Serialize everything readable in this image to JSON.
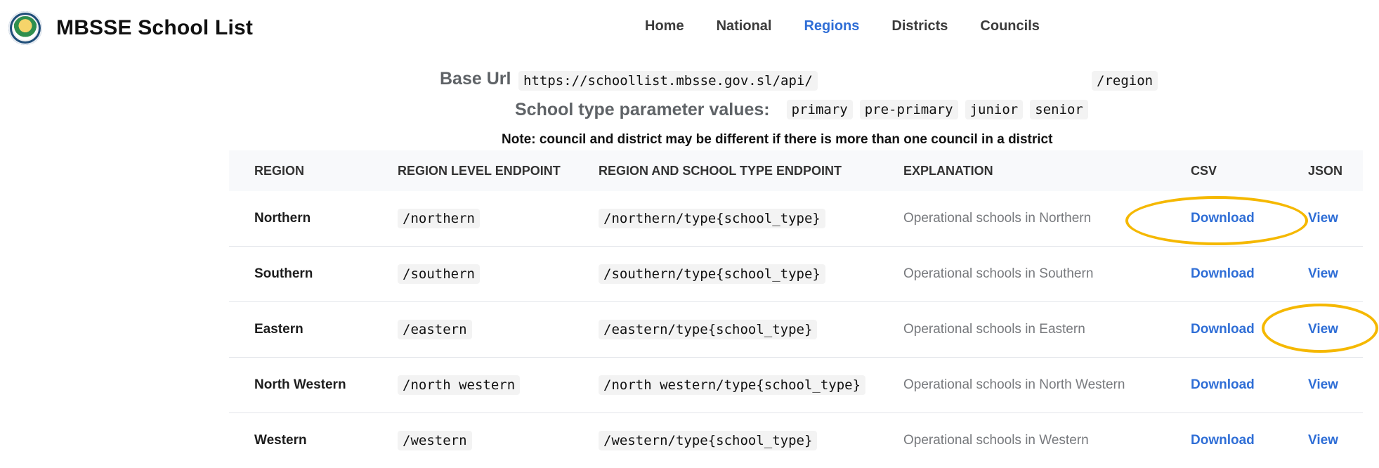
{
  "header": {
    "title": "MBSSE School List",
    "logo_icon": "sierra-leone-coat-of-arms-icon",
    "nav": [
      {
        "label": "Home",
        "active": false
      },
      {
        "label": "National",
        "active": false
      },
      {
        "label": "Regions",
        "active": true
      },
      {
        "label": "Districts",
        "active": false
      },
      {
        "label": "Councils",
        "active": false
      }
    ]
  },
  "info": {
    "base_label": "Base Url",
    "base_url": "https://schoollist.mbsse.gov.sl/api/",
    "base_suffix": "/region",
    "type_label": "School type parameter values:",
    "types": [
      "primary",
      "pre-primary",
      "junior",
      "senior"
    ],
    "note": "Note: council and district may be different if there is more than one council in a district"
  },
  "table": {
    "headers": [
      "REGION",
      "REGION LEVEL ENDPOINT",
      "REGION AND SCHOOL TYPE ENDPOINT",
      "EXPLANATION",
      "CSV",
      "JSON"
    ],
    "rows": [
      {
        "region": "Northern",
        "endpoint": "/northern",
        "type_endpoint": "/northern/type{school_type}",
        "explanation": "Operational schools in Northern",
        "csv": "Download",
        "json": "View"
      },
      {
        "region": "Southern",
        "endpoint": "/southern",
        "type_endpoint": "/southern/type{school_type}",
        "explanation": "Operational schools in Southern",
        "csv": "Download",
        "json": "View"
      },
      {
        "region": "Eastern",
        "endpoint": "/eastern",
        "type_endpoint": "/eastern/type{school_type}",
        "explanation": "Operational schools in Eastern",
        "csv": "Download",
        "json": "View"
      },
      {
        "region": "North Western",
        "endpoint": "/north western",
        "type_endpoint": "/north western/type{school_type}",
        "explanation": "Operational schools in North Western",
        "csv": "Download",
        "json": "View"
      },
      {
        "region": "Western",
        "endpoint": "/western",
        "type_endpoint": "/western/type{school_type}",
        "explanation": "Operational schools in Western",
        "csv": "Download",
        "json": "View"
      }
    ]
  },
  "colors": {
    "accent_link": "#2f6ed6",
    "highlight": "#f5b800"
  }
}
